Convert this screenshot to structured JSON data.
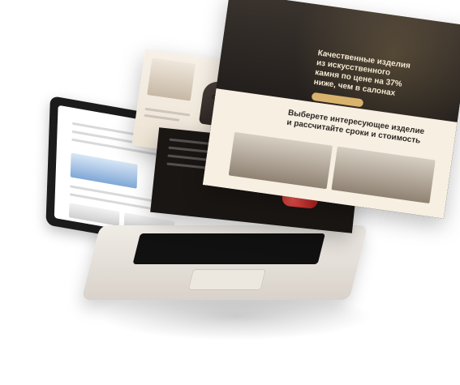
{
  "screens": {
    "right": {
      "headline_lines": [
        "Качественные изделия",
        "из искусственного",
        "камня по цене на 37%",
        "ниже, чем в салонах"
      ],
      "subheadline_lines": [
        "Выберете интересующее изделие",
        "и рассчитайте сроки и стоимость"
      ]
    }
  }
}
